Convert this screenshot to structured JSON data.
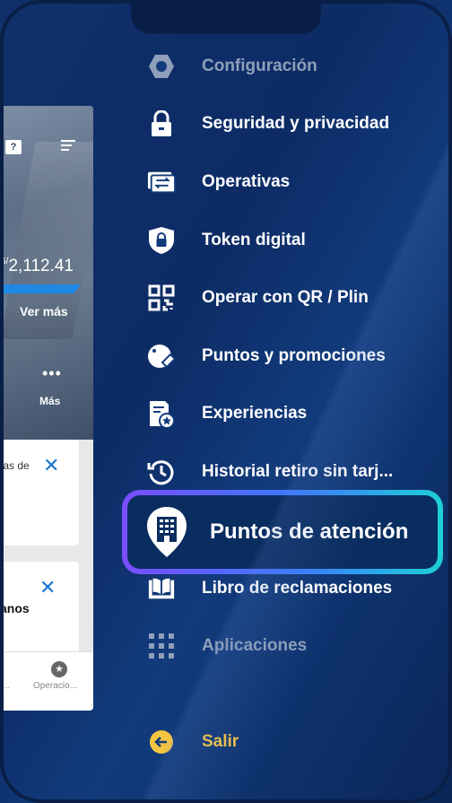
{
  "preview": {
    "amount_prefix": "S/",
    "amount": "2,112.41",
    "ver_mas": "Ver más",
    "mas": "Más",
    "help_icon": "?",
    "card1_text": "tas de",
    "card2_text": "anos",
    "tab1_label": "i...",
    "tab2_label": "Operacio..."
  },
  "menu": {
    "items": [
      {
        "label": "Configuración",
        "icon": "gear-icon"
      },
      {
        "label": "Seguridad y privacidad",
        "icon": "lock-icon"
      },
      {
        "label": "Operativas",
        "icon": "transfer-icon"
      },
      {
        "label": "Token digital",
        "icon": "shield-lock-icon"
      },
      {
        "label": "Operar con QR / Plin",
        "icon": "qr-icon"
      },
      {
        "label": "Puntos y promociones",
        "icon": "tag-icon"
      },
      {
        "label": "Experiencias",
        "icon": "document-star-icon"
      },
      {
        "label": "Historial retiro sin tarj...",
        "icon": "history-icon"
      },
      {
        "label": "Libro de reclamaciones",
        "icon": "book-icon"
      },
      {
        "label": "Aplicaciones",
        "icon": "grid-icon"
      }
    ],
    "highlighted": {
      "label": "Puntos de atención",
      "icon": "building-location-icon"
    },
    "logout": {
      "label": "Salir",
      "icon": "arrow-left-icon"
    }
  },
  "colors": {
    "background": "#0d2c66",
    "highlight_gradient_start": "#7b4dff",
    "highlight_gradient_end": "#1ed0d6",
    "logout": "#f5c542",
    "dimmed": "#8f9fba"
  }
}
